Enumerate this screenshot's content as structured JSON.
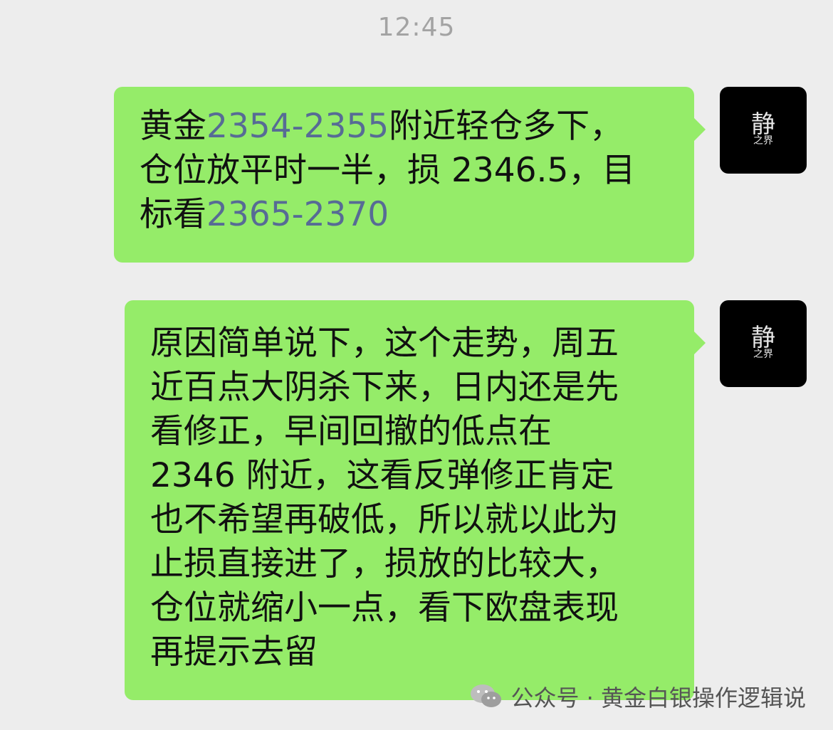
{
  "timestamp": "12:45",
  "messages": [
    {
      "lines": [
        {
          "parts": [
            {
              "text": "黄金",
              "link": false
            },
            {
              "text": "2354-2355",
              "link": true
            },
            {
              "text": "附近轻仓多下，",
              "link": false
            }
          ]
        },
        {
          "parts": [
            {
              "text": "仓位放平时一半，损 2346.5，目",
              "link": false
            }
          ]
        },
        {
          "parts": [
            {
              "text": "标看",
              "link": false
            },
            {
              "text": "2365-2370",
              "link": true
            }
          ]
        }
      ]
    },
    {
      "lines": [
        {
          "parts": [
            {
              "text": "原因简单说下，这个走势，周五",
              "link": false
            }
          ]
        },
        {
          "parts": [
            {
              "text": "近百点大阴杀下来，日内还是先",
              "link": false
            }
          ]
        },
        {
          "parts": [
            {
              "text": "看修正，早间回撤的低点在",
              "link": false
            }
          ]
        },
        {
          "parts": [
            {
              "text": "2346 附近，这看反弹修正肯定",
              "link": false
            }
          ]
        },
        {
          "parts": [
            {
              "text": "也不希望再破低，所以就以此为",
              "link": false
            }
          ]
        },
        {
          "parts": [
            {
              "text": "止损直接进了，损放的比较大，",
              "link": false
            }
          ]
        },
        {
          "parts": [
            {
              "text": "仓位就缩小一点，看下欧盘表现",
              "link": false
            }
          ]
        },
        {
          "parts": [
            {
              "text": "再提示去留",
              "link": false
            }
          ]
        }
      ]
    }
  ],
  "avatar": {
    "main_char": "静",
    "sub_chars": "之界"
  },
  "watermark": {
    "text": "公众号 · 黄金白银操作逻辑说",
    "icon": "wechat-icon"
  },
  "colors": {
    "background": "#ededed",
    "bubble": "#95ec69",
    "link": "#576b95",
    "avatar_bg": "#000000"
  }
}
